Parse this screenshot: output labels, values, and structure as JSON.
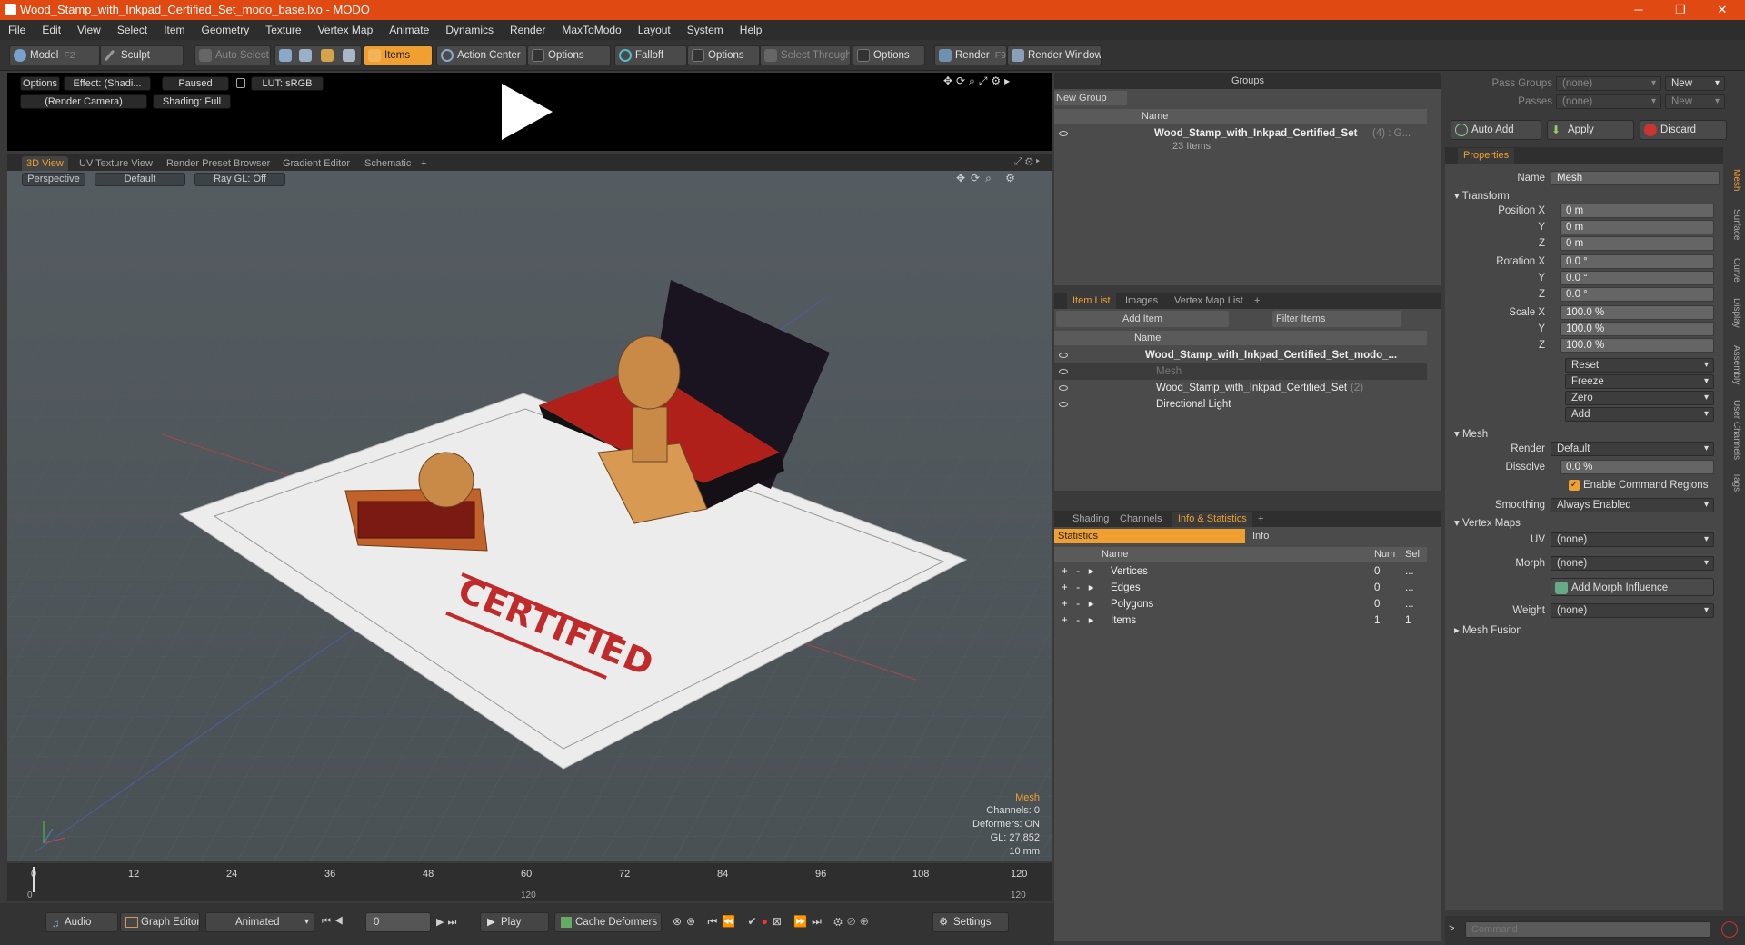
{
  "window": {
    "title": "Wood_Stamp_with_Inkpad_Certified_Set_modo_base.lxo - MODO"
  },
  "menu": [
    "File",
    "Edit",
    "View",
    "Select",
    "Item",
    "Geometry",
    "Texture",
    "Vertex Map",
    "Animate",
    "Dynamics",
    "Render",
    "MaxToModo",
    "Layout",
    "System",
    "Help"
  ],
  "toolbar": {
    "model": "Model",
    "model_key": "F2",
    "sculpt": "Sculpt",
    "auto_select": "Auto Select",
    "items": "Items",
    "action_center": "Action Center",
    "options1": "Options",
    "falloff": "Falloff",
    "options2": "Options",
    "select_through": "Select Through",
    "options3": "Options",
    "render": "Render",
    "render_key": "F9",
    "render_window": "Render Window"
  },
  "render_preview": {
    "options": "Options",
    "effect": "Effect: (Shadi...",
    "paused": "Paused",
    "lut": "LUT: sRGB",
    "camera": "(Render Camera)",
    "shading": "Shading: Full"
  },
  "viewport_tabs": [
    "3D View",
    "UV Texture View",
    "Render Preset Browser",
    "Gradient Editor",
    "Schematic",
    "+"
  ],
  "viewport": {
    "perspective": "Perspective",
    "default": "Default",
    "raygl": "Ray GL: Off",
    "stamp_text": "CERTIFIED",
    "info_title": "Mesh",
    "info_lines": [
      "Channels: 0",
      "Deformers: ON",
      "GL: 27,852",
      "10 mm"
    ]
  },
  "timeline": {
    "ticks": [
      "0",
      "12",
      "24",
      "36",
      "48",
      "60",
      "72",
      "84",
      "96",
      "108",
      "120"
    ],
    "start": "0",
    "mid": "120",
    "end": "120"
  },
  "bottom": {
    "audio": "Audio",
    "graph_editor": "Graph Editor",
    "animated": "Animated",
    "frame": "0",
    "play": "Play",
    "cache": "Cache Deformers",
    "settings": "Settings"
  },
  "groups": {
    "title": "Groups",
    "new_group": "New Group",
    "col_name": "Name",
    "item_name": "Wood_Stamp_with_Inkpad_Certified_Set",
    "item_count": "(4) : G...",
    "item_sub": "23 Items"
  },
  "item_list": {
    "tabs": [
      "Item List",
      "Images",
      "Vertex Map List",
      "+"
    ],
    "add_item": "Add Item",
    "filter": "Filter Items",
    "col_name": "Name",
    "rows": [
      "Wood_Stamp_with_Inkpad_Certified_Set_modo_...",
      "Mesh",
      "Wood_Stamp_with_Inkpad_Certified_Set",
      "Directional Light"
    ],
    "row2_count": "(2)"
  },
  "stats": {
    "tabs": [
      "Shading",
      "Channels",
      "Info & Statistics",
      "+"
    ],
    "sub_tabs": [
      "Statistics",
      "Info"
    ],
    "cols": [
      "Name",
      "Num",
      "Sel"
    ],
    "rows": [
      {
        "name": "Vertices",
        "num": "0",
        "sel": "..."
      },
      {
        "name": "Edges",
        "num": "0",
        "sel": "..."
      },
      {
        "name": "Polygons",
        "num": "0",
        "sel": "..."
      },
      {
        "name": "Items",
        "num": "1",
        "sel": "1"
      }
    ]
  },
  "pass": {
    "pass_groups": "Pass Groups",
    "passes": "Passes",
    "none1": "(none)",
    "none2": "(none)",
    "new1": "New",
    "new2": "New",
    "auto_add": "Auto Add",
    "apply": "Apply",
    "discard": "Discard"
  },
  "properties": {
    "tab": "Properties",
    "name_label": "Name",
    "name_value": "Mesh",
    "transform": "Transform",
    "pos_label": "Position X",
    "rot_label": "Rotation X",
    "scale_label": "Scale X",
    "y": "Y",
    "z": "Z",
    "pos": [
      "0 m",
      "0 m",
      "0 m"
    ],
    "rot": [
      "0.0 °",
      "0.0 °",
      "0.0 °"
    ],
    "scale": [
      "100.0 %",
      "100.0 %",
      "100.0 %"
    ],
    "reset": "Reset",
    "freeze": "Freeze",
    "zero": "Zero",
    "add": "Add",
    "mesh": "Mesh",
    "render_label": "Render",
    "render_value": "Default",
    "dissolve_label": "Dissolve",
    "dissolve_value": "0.0 %",
    "enable_cmd": "Enable Command Regions",
    "smoothing_label": "Smoothing",
    "smoothing_value": "Always Enabled",
    "vertex_maps": "Vertex Maps",
    "uv_label": "UV",
    "uv_value": "(none)",
    "morph_label": "Morph",
    "morph_value": "(none)",
    "add_morph": "Add Morph Influence",
    "weight_label": "Weight",
    "weight_value": "(none)",
    "mesh_fusion": "Mesh Fusion",
    "side_tabs": [
      "Mesh",
      "Surface",
      "Curve",
      "Display",
      "Assembly",
      "User Channels",
      "Tags"
    ]
  },
  "command": {
    "placeholder": "Command"
  },
  "colors": {
    "accent": "#f0a030",
    "title": "#e04a12"
  }
}
